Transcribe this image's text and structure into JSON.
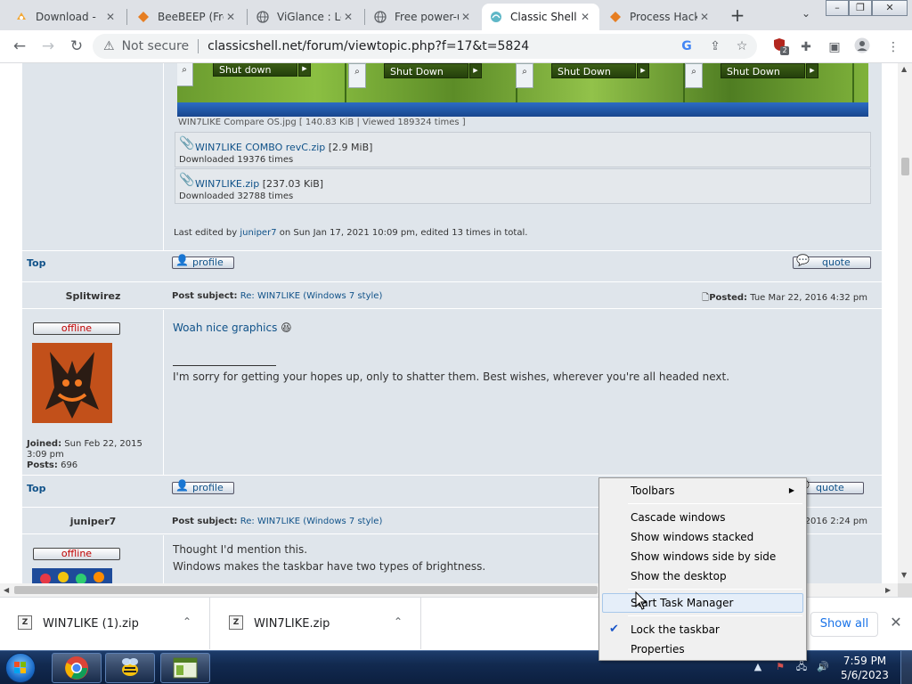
{
  "browser": {
    "tabs": [
      {
        "label": "Download -",
        "icon": "gear-icon"
      },
      {
        "label": "BeeBEEP (Fre",
        "icon": "diamond-icon"
      },
      {
        "label": "ViGlance : Le",
        "icon": "globe-icon"
      },
      {
        "label": "Free power-u",
        "icon": "globe-icon"
      },
      {
        "label": "Classic Shell",
        "icon": "shell-icon",
        "active": true
      },
      {
        "label": "Process Hack",
        "icon": "diamond-icon"
      }
    ],
    "new_tab": "+",
    "address": {
      "security_label": "Not secure",
      "url": "classicshell.net/forum/viewtopic.php?f=17&t=5824"
    },
    "extension_badge": "2",
    "accent": "#1a73e8"
  },
  "forum": {
    "screenshots_buttons": [
      "Shut down",
      "Shut Down",
      "Shut Down",
      "Shut Down"
    ],
    "image_caption": "WIN7LIKE Compare OS.jpg [ 140.83 KiB | Viewed 189324 times ]",
    "attachments": [
      {
        "name": "WIN7LIKE COMBO revC.zip",
        "size": "[2.9 MiB]",
        "downloads": "Downloaded 19376 times"
      },
      {
        "name": "WIN7LIKE.zip",
        "size": "[237.03 KiB]",
        "downloads": "Downloaded 32788 times"
      }
    ],
    "last_edited": {
      "prefix": "Last edited by ",
      "user": "juniper7",
      "suffix": " on Sun Jan 17, 2021 10:09 pm, edited 13 times in total."
    },
    "top_label": "Top",
    "profile_label": "profile",
    "quote_label": "quote",
    "subject_label": "Post subject:",
    "posted_label": "Posted:",
    "offline_label": "offline",
    "posts": [
      {
        "author": "Splitwirez",
        "subject": "Re: WIN7LIKE (Windows 7 style)",
        "posted": "Tue Mar 22, 2016 4:32 pm",
        "body_link": "Woah nice graphics",
        "signature": "I'm sorry for getting your hopes up, only to shatter them. Best wishes, wherever you're all headed next.",
        "joined_label": "Joined:",
        "joined": "Sun Feb 22, 2015 3:09 pm",
        "posts_label": "Posts:",
        "posts": "696"
      },
      {
        "author": "juniper7",
        "subject": "Re: WIN7LIKE (Windows 7 style)",
        "posted_partial": "2016 2:24 pm",
        "body_lines": [
          "Thought I'd mention this.",
          "Windows makes the taskbar have two types of brightness."
        ]
      }
    ]
  },
  "downloads": {
    "items": [
      {
        "name": "WIN7LIKE (1).zip"
      },
      {
        "name": "WIN7LIKE.zip"
      }
    ],
    "show_all": "Show all"
  },
  "context_menu": {
    "items": [
      {
        "label": "Toolbars",
        "submenu": true
      },
      {
        "label": "Cascade windows"
      },
      {
        "label": "Show windows stacked"
      },
      {
        "label": "Show windows side by side"
      },
      {
        "label": "Show the desktop"
      },
      {
        "label": "Start Task Manager",
        "highlighted": true
      },
      {
        "label": "Lock the taskbar",
        "checked": true
      },
      {
        "label": "Properties"
      }
    ]
  },
  "taskbar": {
    "time": "7:59 PM",
    "date": "5/6/2023"
  }
}
